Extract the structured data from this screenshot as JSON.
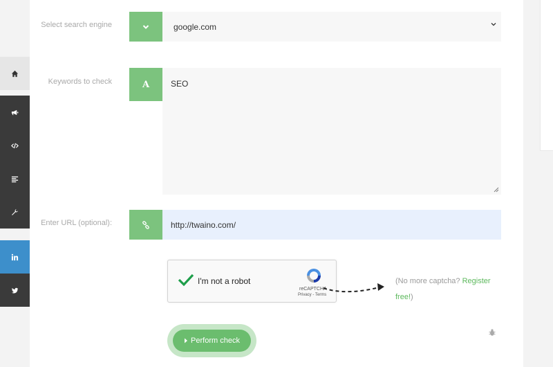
{
  "nav_rail": {
    "items": [
      {
        "name": "home",
        "icon": "home-icon"
      },
      {
        "name": "megaphone",
        "icon": "megaphone-icon"
      },
      {
        "name": "code",
        "icon": "code-icon"
      },
      {
        "name": "text",
        "icon": "align-left-icon"
      },
      {
        "name": "tools",
        "icon": "wrench-icon"
      },
      {
        "name": "linkedin",
        "icon": "linkedin-icon"
      },
      {
        "name": "twitter",
        "icon": "twitter-icon"
      }
    ],
    "colors": {
      "home_bg": "#e6e6e6",
      "dark_bg": "#3a3a3a",
      "linkedin_bg": "#3d8fcb"
    }
  },
  "form": {
    "engine_label": "Select search engine",
    "engine_value": "google.com",
    "keywords_label": "Keywords to check",
    "keywords_addon": "A",
    "keywords_value": "SEO",
    "url_label": "Enter URL (optional):",
    "url_value": "http://twaino.com/"
  },
  "captcha": {
    "label": "I'm not a robot",
    "brand": "reCAPTCHA",
    "links": "Privacy - Terms",
    "checked": true
  },
  "promo": {
    "text": "(No more captcha? ",
    "link": "Register free!",
    "close": ")"
  },
  "actions": {
    "submit_label": "Perform check"
  },
  "colors": {
    "accent_green": "#7cc37e",
    "button_green": "#6bbd6e",
    "link_green": "#5cb85c",
    "url_field_bg": "#e8f0fd"
  }
}
